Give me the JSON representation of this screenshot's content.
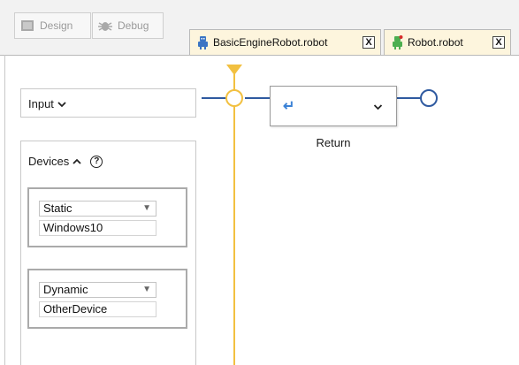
{
  "toolbar": {
    "design_label": "Design",
    "debug_label": "Debug"
  },
  "tabs": [
    {
      "label": "BasicEngineRobot.robot",
      "close": "X"
    },
    {
      "label": "Robot.robot",
      "close": "X"
    }
  ],
  "left_panel": {
    "input_title": "Input",
    "devices_title": "Devices",
    "help_glyph": "?",
    "devices": [
      {
        "mode": "Static",
        "name": "Windows10"
      },
      {
        "mode": "Dynamic",
        "name": "OtherDevice"
      }
    ]
  },
  "flow": {
    "return_icon": "↵",
    "step_label": "Return"
  },
  "colors": {
    "flow_line": "#2f5aa0",
    "branch_line": "#f2c040",
    "tab_bg": "#fdf5dd",
    "return_icon": "#3b82d6"
  },
  "icons": [
    "design-icon",
    "debug-icon",
    "robot-icon",
    "close-icon",
    "chevron-down-icon",
    "chevron-up-icon",
    "help-icon",
    "dropdown-arrow-icon",
    "return-icon"
  ]
}
